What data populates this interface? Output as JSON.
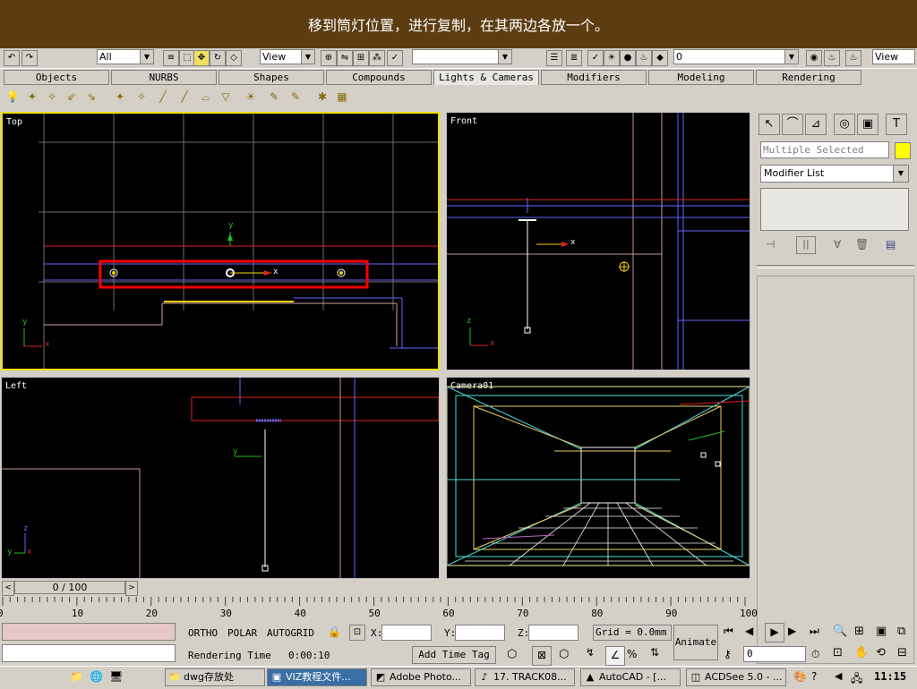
{
  "caption": "移到筒灯位置，进行复制，在其两边各放一个。",
  "toolbar": {
    "selection_filter": "All",
    "ref_coord_left": "View",
    "ref_coord_right": "View",
    "number_field": "0"
  },
  "tabs": [
    "Objects",
    "NURBS",
    "Shapes",
    "Compounds",
    "Lights & Cameras",
    "Modifiers",
    "Modeling",
    "Rendering"
  ],
  "active_tab": "Lights & Cameras",
  "viewports": {
    "top": {
      "label": "Top"
    },
    "front": {
      "label": "Front"
    },
    "left": {
      "label": "Left"
    },
    "camera": {
      "label": "Camera01"
    }
  },
  "axis": {
    "x": "x",
    "y": "y",
    "z": "z"
  },
  "command_panel": {
    "name_field": "Multiple Selected",
    "name_color": "#ffff00",
    "modifier_list": "Modifier List"
  },
  "time_slider": {
    "label": "0 / 100"
  },
  "ruler_ticks": [
    "0",
    "10",
    "20",
    "30",
    "40",
    "50",
    "60",
    "70",
    "80",
    "90",
    "100"
  ],
  "status": {
    "ortho": "ORTHO",
    "polar": "POLAR",
    "autogrid": "AUTOGRID",
    "x_label": "X:",
    "y_label": "Y:",
    "z_label": "Z:",
    "grid": "Grid = 0.0mm",
    "rendering_time_label": "Rendering Time",
    "rendering_time": "0:00:10",
    "add_time_tag": "Add Time Tag",
    "animate": "Animate",
    "frame_value": "0"
  },
  "taskbar": {
    "tasks": [
      "dwg存放处",
      "VIZ教程文件...",
      "Adobe Photo...",
      "17. TRACK08...",
      "AutoCAD - [...",
      "ACDSee 5.0 - ..."
    ],
    "active_task": "VIZ教程文件...",
    "clock": "11:15"
  },
  "colors": {
    "viewport_active_border": "#f0e000",
    "selection_box": "#ff0000",
    "caption_bg": "#5c3d12"
  }
}
